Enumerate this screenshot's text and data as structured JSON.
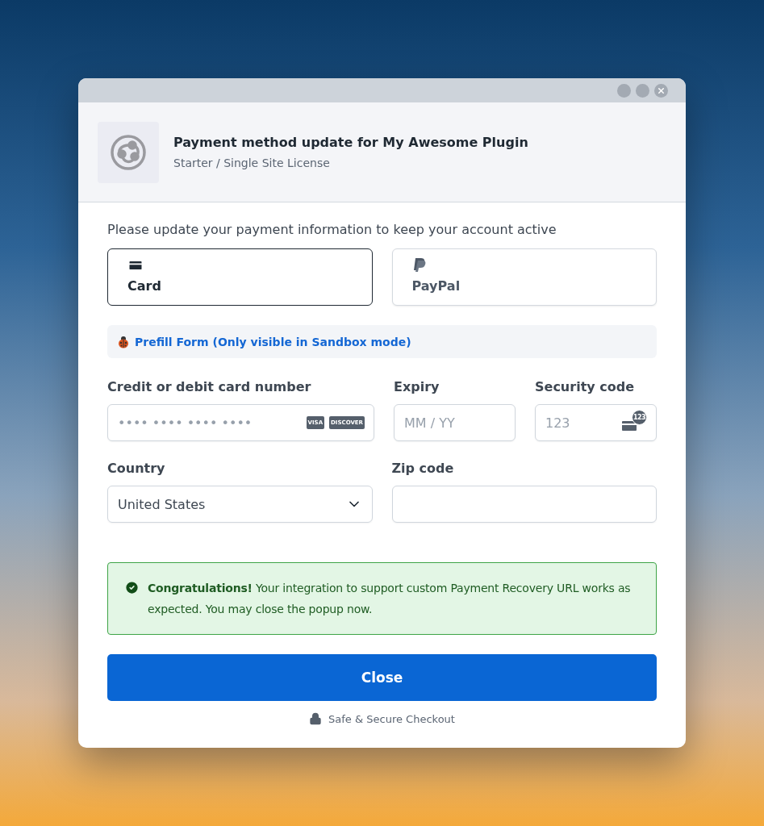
{
  "header": {
    "title": "Payment method update for My Awesome Plugin",
    "subtitle": "Starter / Single Site License"
  },
  "intro": "Please update your payment information to keep your account active",
  "payment_methods": [
    {
      "kind": "card",
      "label": "Card",
      "selected": true
    },
    {
      "kind": "paypal",
      "label": "PayPal",
      "selected": false
    }
  ],
  "prefill_link": "Prefill Form (Only visible in Sandbox mode)",
  "card_number": {
    "label": "Credit or debit card number",
    "placeholder": "•••• •••• •••• ••••",
    "brands": [
      "VISA",
      "DISCOVER"
    ]
  },
  "expiry": {
    "label": "Expiry",
    "placeholder": "MM / YY"
  },
  "security_code": {
    "label": "Security code",
    "placeholder": "123",
    "badge": "123"
  },
  "country": {
    "label": "Country",
    "value": "United States"
  },
  "zip": {
    "label": "Zip code"
  },
  "alert": {
    "kind": "success",
    "text": "**Congratulations!** Your integration to support custom Payment Recovery URL works as expected. You may close the popup now."
  },
  "close_button": "Close",
  "footer": "Safe & Secure Checkout"
}
